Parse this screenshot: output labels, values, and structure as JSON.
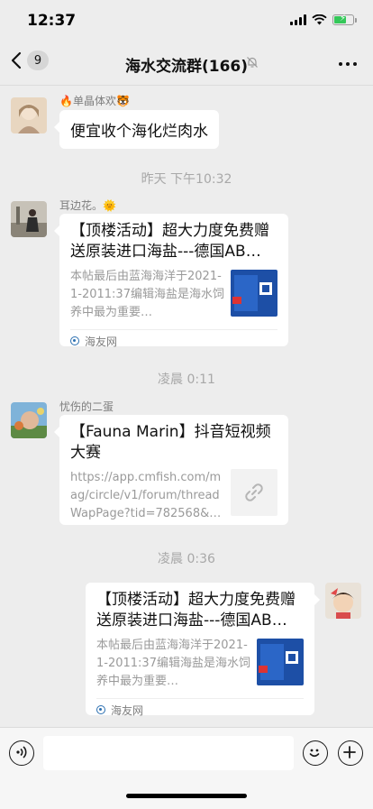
{
  "status_bar": {
    "time": "12:37"
  },
  "header": {
    "back_badge": "9",
    "title": "海水交流群(166)"
  },
  "messages": [
    {
      "sender": "🔥单晶体欢🐯",
      "text": "便宜收个海化烂肉水"
    },
    {
      "timestamp": "昨天 下午10:32"
    },
    {
      "sender": "耳边花。🌞",
      "card_title": "【顶楼活动】超大力度免费赠送原装进口海盐---德国AB…",
      "card_desc": "本帖最后由蓝海海洋于2021-1-2011:37编辑海盐是海水饲养中最为重要…",
      "card_source": "海友网"
    },
    {
      "timestamp": "凌晨 0:11"
    },
    {
      "sender": "忧伤的二蛋",
      "card_title": "【Fauna Marin】抖音短视频大赛",
      "card_desc": "https://app.cmfish.com/mag/circle/v1/forum/threadWapPage?tid=782568&…"
    },
    {
      "timestamp": "凌晨 0:36"
    },
    {
      "card_title": "【顶楼活动】超大力度免费赠送原装进口海盐---德国AB…",
      "card_desc": "本帖最后由蓝海海洋于2021-1-2011:37编辑海盐是海水饲养中最为重要…",
      "card_source": "海友网"
    }
  ],
  "input": {
    "value": "",
    "placeholder": ""
  },
  "icons": {
    "back": "chevron-left-icon",
    "mute": "bell-slash-icon",
    "more": "more-icon",
    "voice": "voice-icon",
    "emoji": "emoji-icon",
    "plus": "plus-icon",
    "link": "link-icon",
    "source": "site-icon"
  },
  "colors": {
    "background": "#ededed",
    "bubble": "#ffffff",
    "battery": "#34c759",
    "secondary_text": "#7d7d7d"
  },
  "battery_level": 0.6
}
